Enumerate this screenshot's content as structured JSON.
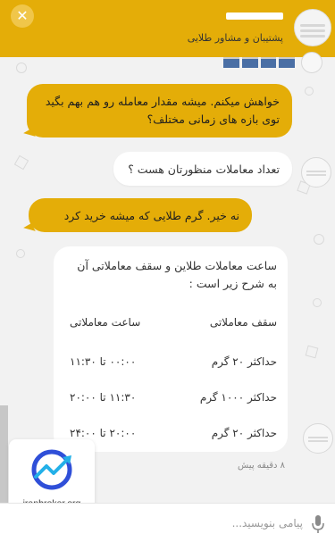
{
  "header": {
    "subtitle": "پشتیبان و مشاور طلایی",
    "close_icon": "close-icon"
  },
  "messages": [
    {
      "from": "agent",
      "text": "خواهش میکنم. میشه مقدار معامله رو هم بهم بگید توی بازه های زمانی مختلف؟"
    },
    {
      "from": "user",
      "text": "تعداد معاملات منظورتان هست ؟"
    },
    {
      "from": "agent",
      "text": "نه خیر. گرم طلایی که میشه خرید کرد"
    }
  ],
  "trading_table": {
    "intro": "ساعت معاملات طلاین و سقف معاملاتی آن به شرح زیر است :",
    "headers": [
      "سقف معاملاتی",
      "ساعت معاملاتی"
    ],
    "rows": [
      [
        "حداکثر ۲۰ گرم",
        "۰۰:۰۰ تا ۱۱:۳۰"
      ],
      [
        "حداکثر ۱۰۰۰ گرم",
        "۱۱:۳۰ تا ۲۰:۰۰"
      ],
      [
        "حداکثر ۲۰ گرم",
        "۲۰:۰۰ تا ۲۴:۰۰"
      ]
    ]
  },
  "timestamp": "۸ دقیقه پیش",
  "input": {
    "placeholder": "پیامی بنویسید..."
  },
  "logo": {
    "text": "iranbroker.org"
  },
  "colors": {
    "accent": "#e4ad08",
    "background": "#f2f2f2"
  }
}
